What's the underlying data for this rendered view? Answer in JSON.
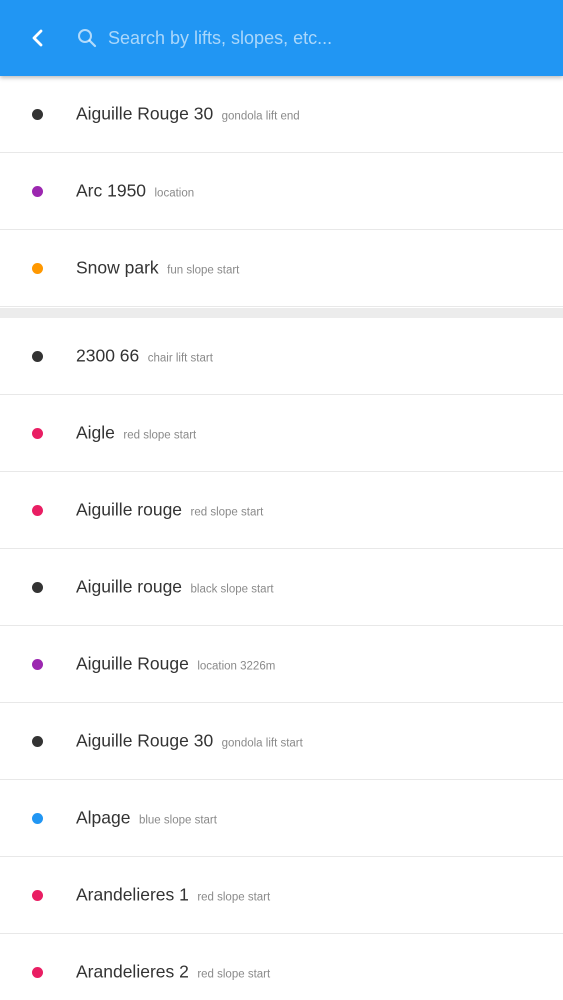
{
  "search": {
    "placeholder": "Search by lifts, slopes, etc..."
  },
  "colors": {
    "header": "#2196f3",
    "black": "#333333",
    "purple": "#9c27b0",
    "orange": "#ff9800",
    "red": "#e91e63",
    "blue": "#2196f3"
  },
  "recent": [
    {
      "name": "Aiguille Rouge 30",
      "type": "gondola lift end",
      "color": "#333333"
    },
    {
      "name": "Arc 1950",
      "type": "location",
      "color": "#9c27b0"
    },
    {
      "name": "Snow park",
      "type": "fun slope start",
      "color": "#ff9800"
    }
  ],
  "results": [
    {
      "name": "2300 66",
      "type": "chair lift start",
      "color": "#333333"
    },
    {
      "name": "Aigle",
      "type": "red slope start",
      "color": "#e91e63"
    },
    {
      "name": "Aiguille rouge",
      "type": "red slope start",
      "color": "#e91e63"
    },
    {
      "name": "Aiguille rouge",
      "type": "black slope start",
      "color": "#333333"
    },
    {
      "name": "Aiguille Rouge",
      "type": "location 3226m",
      "color": "#9c27b0"
    },
    {
      "name": "Aiguille Rouge 30",
      "type": "gondola lift start",
      "color": "#333333"
    },
    {
      "name": "Alpage",
      "type": "blue slope start",
      "color": "#2196f3"
    },
    {
      "name": "Arandelieres 1",
      "type": "red slope start",
      "color": "#e91e63"
    },
    {
      "name": "Arandelieres 2",
      "type": "red slope start",
      "color": "#e91e63"
    }
  ]
}
